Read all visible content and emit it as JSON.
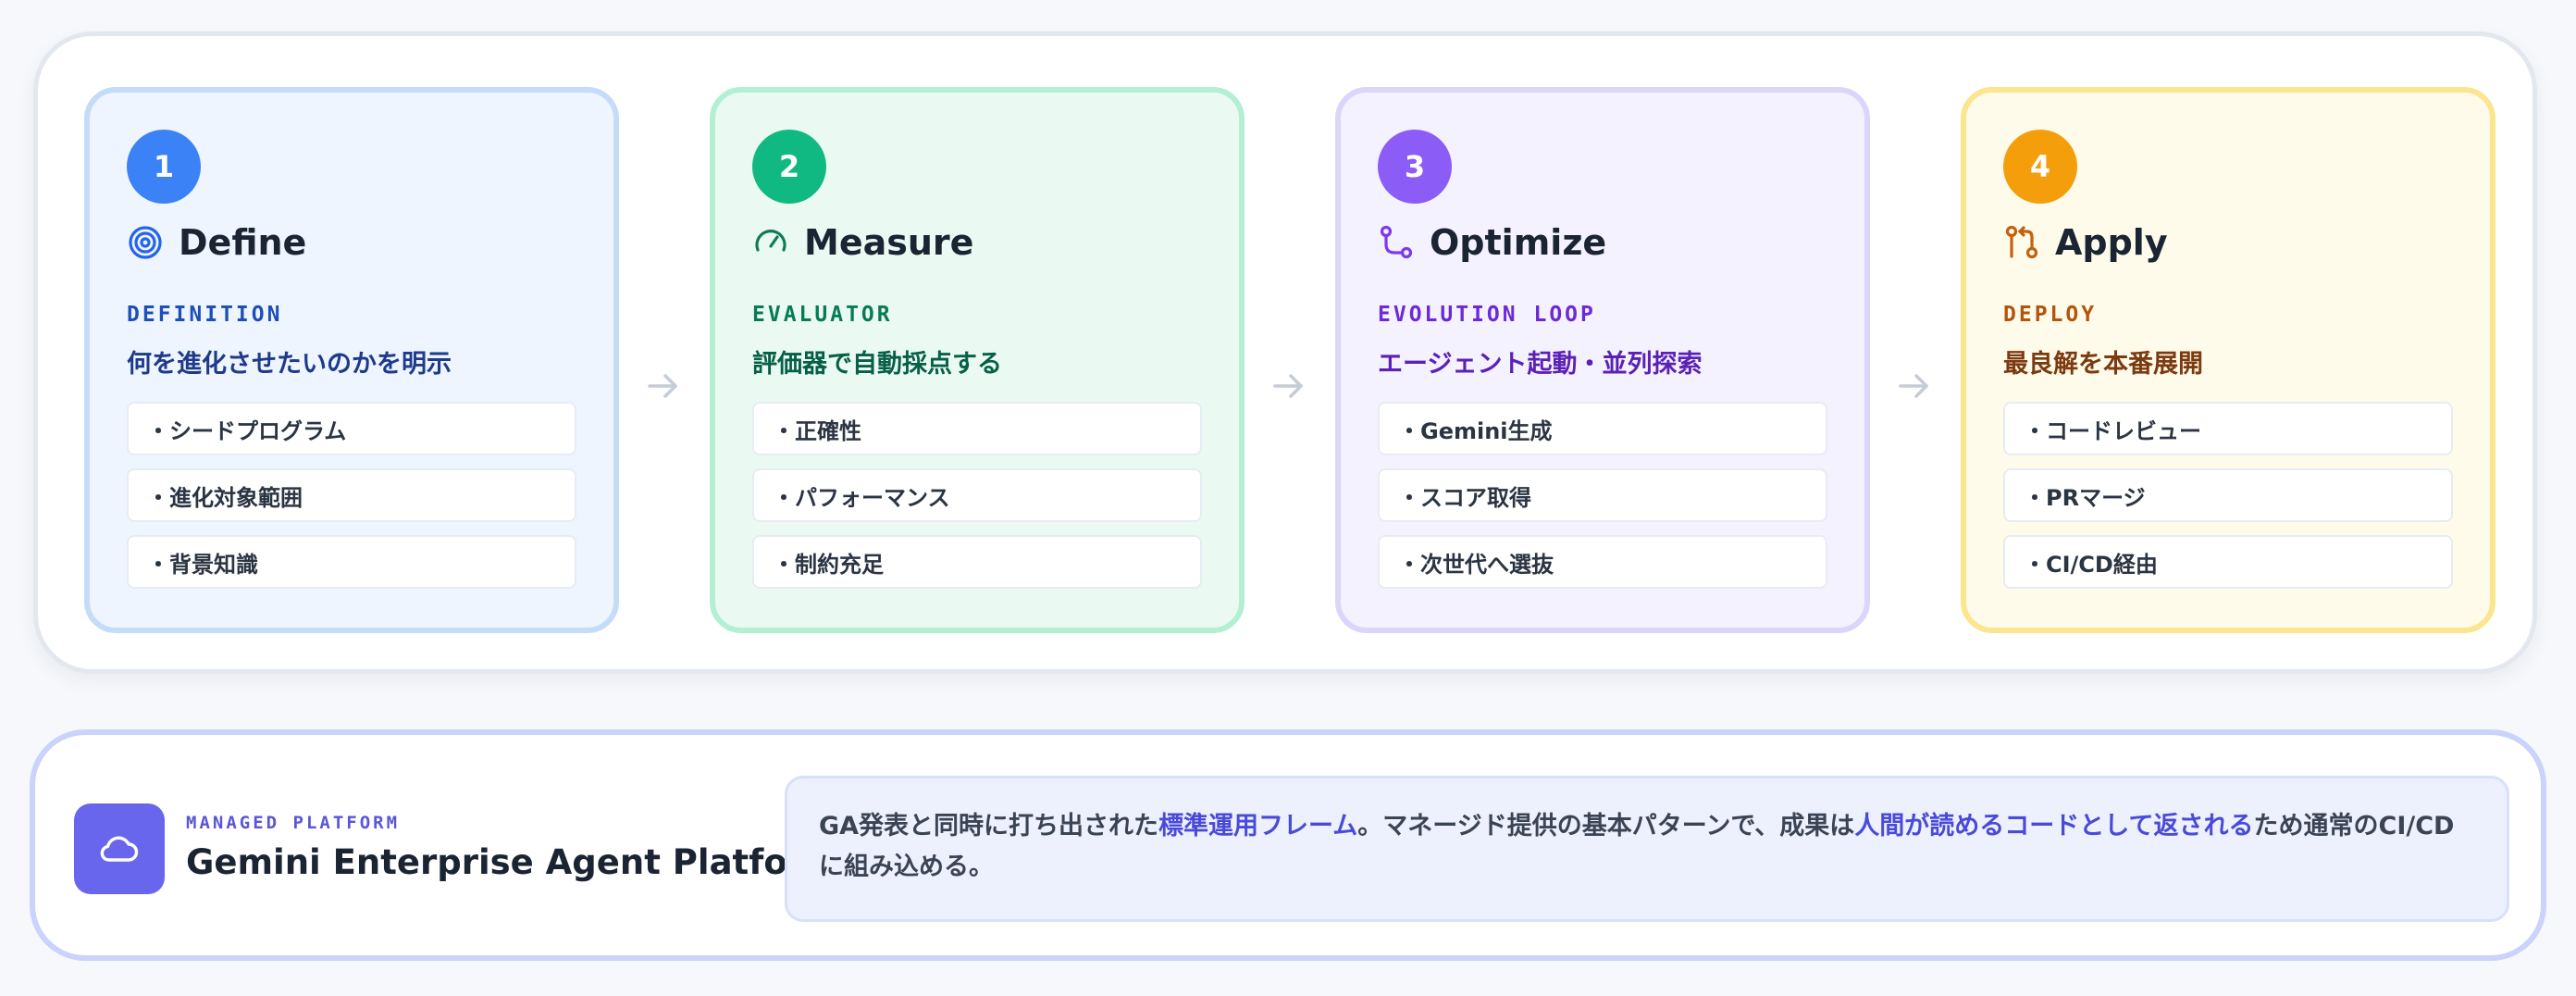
{
  "steps": [
    {
      "number": "1",
      "title": "Define",
      "tag": "DEFINITION",
      "subtitle": "何を進化させたいのかを明示",
      "items": [
        "・シードプログラム",
        "・進化対象範囲",
        "・背景知識"
      ],
      "icon": "target-icon",
      "colors": {
        "circle": "#3b82f6",
        "bg": "#eef5ff",
        "border": "#c4dcf8",
        "tag": "#1d4fb8",
        "subtitle": "#1e3a8a"
      }
    },
    {
      "number": "2",
      "title": "Measure",
      "tag": "EVALUATOR",
      "subtitle": "評価器で自動採点する",
      "items": [
        "・正確性",
        "・パフォーマンス",
        "・制約充足"
      ],
      "icon": "gauge-icon",
      "colors": {
        "circle": "#10b981",
        "bg": "#eafaf3",
        "border": "#b3efd3",
        "tag": "#087a55",
        "subtitle": "#065f46"
      }
    },
    {
      "number": "3",
      "title": "Optimize",
      "tag": "EVOLUTION LOOP",
      "subtitle": "エージェント起動・並列探索",
      "items": [
        "・Gemini生成",
        "・スコア取得",
        "・次世代へ選抜"
      ],
      "icon": "branch-icon",
      "colors": {
        "circle": "#8b5cf6",
        "bg": "#f4f2fe",
        "border": "#dcd5fa",
        "tag": "#6d28d9",
        "subtitle": "#5b21b6"
      }
    },
    {
      "number": "4",
      "title": "Apply",
      "tag": "DEPLOY",
      "subtitle": "最良解を本番展開",
      "items": [
        "・コードレビュー",
        "・PRマージ",
        "・CI/CD経由"
      ],
      "icon": "pull-request-icon",
      "colors": {
        "circle": "#f59e0b",
        "bg": "#fefbeb",
        "border": "#fbe58f",
        "tag": "#b45309",
        "subtitle": "#7c3a10"
      }
    }
  ],
  "platform": {
    "tag": "MANAGED PLATFORM",
    "name": "Gemini Enterprise Agent Platform",
    "icon": "cloud-icon",
    "description": {
      "part1": "GA発表と同時に打ち出された",
      "highlight1": "標準運用フレーム",
      "part2": "。マネージド提供の基本パターンで、成果は",
      "highlight2": "人間が読めるコードとして返される",
      "part3": "ため通常のCI/CDに組み込める。"
    }
  }
}
